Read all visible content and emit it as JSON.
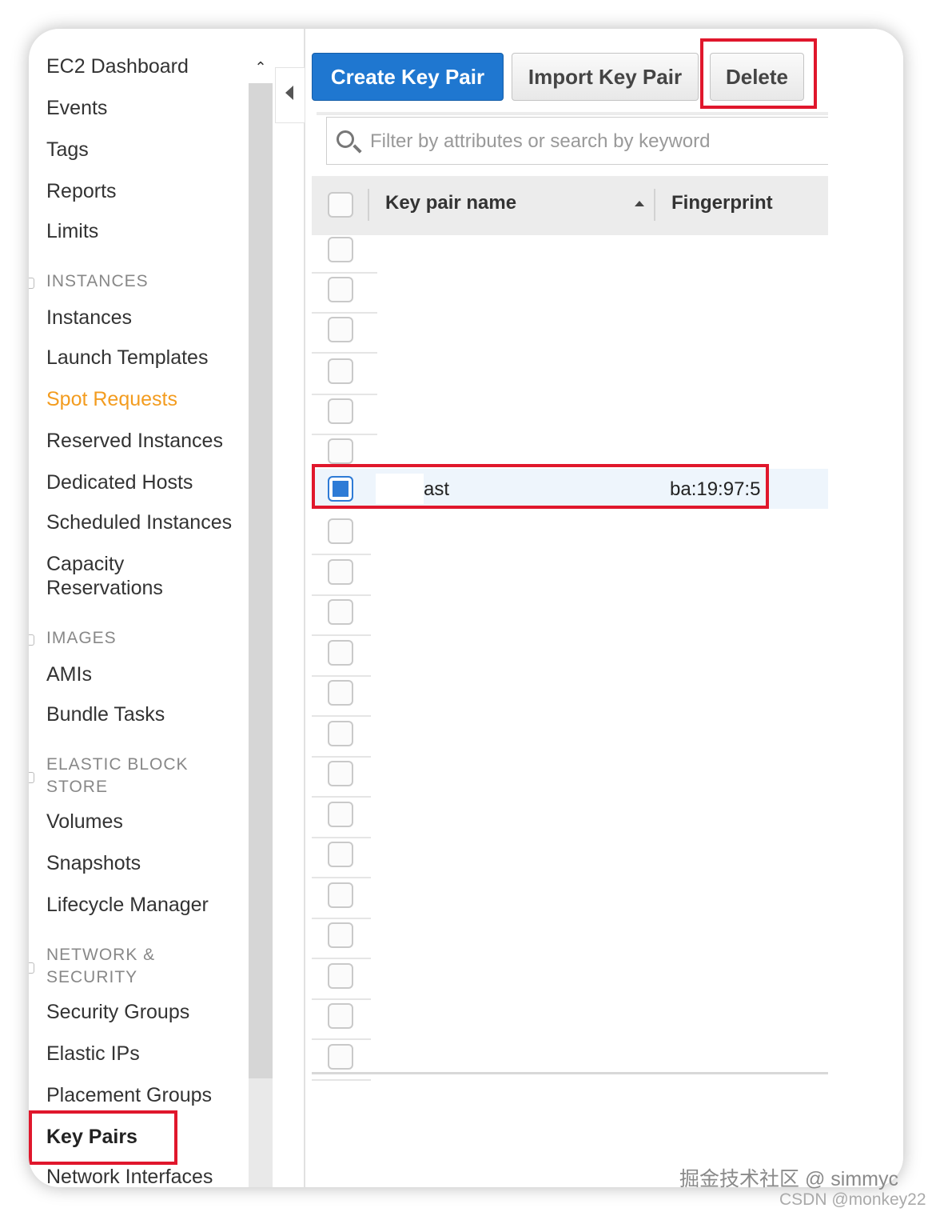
{
  "sidebar": {
    "items": [
      {
        "label": "EC2 Dashboard"
      },
      {
        "label": "Events"
      },
      {
        "label": "Tags"
      },
      {
        "label": "Reports"
      },
      {
        "label": "Limits"
      },
      {
        "label": "Instances"
      },
      {
        "label": "Launch Templates"
      },
      {
        "label": "Spot Requests"
      },
      {
        "label": "Reserved Instances"
      },
      {
        "label": "Dedicated Hosts"
      },
      {
        "label": "Scheduled Instances"
      },
      {
        "label": "Capacity Reservations"
      },
      {
        "label": "AMIs"
      },
      {
        "label": "Bundle Tasks"
      },
      {
        "label": "Volumes"
      },
      {
        "label": "Snapshots"
      },
      {
        "label": "Lifecycle Manager"
      },
      {
        "label": "Security Groups"
      },
      {
        "label": "Elastic IPs"
      },
      {
        "label": "Placement Groups"
      },
      {
        "label": "Key Pairs"
      },
      {
        "label": "Network Interfaces"
      }
    ],
    "sections": {
      "instances": "INSTANCES",
      "images": "IMAGES",
      "ebs": "ELASTIC BLOCK STORE",
      "network": "NETWORK & SECURITY"
    },
    "active_item": "Key Pairs"
  },
  "toolbar": {
    "create_label": "Create Key Pair",
    "import_label": "Import Key Pair",
    "delete_label": "Delete"
  },
  "search": {
    "placeholder": "Filter by attributes or search by keyword",
    "value": ""
  },
  "table": {
    "columns": [
      "Key pair name",
      "Fingerprint"
    ],
    "sort_column": "Key pair name",
    "sort_direction": "ascending",
    "selected_row": {
      "name": "ast",
      "fingerprint": "ba:19:97:5"
    }
  },
  "watermark": {
    "line1": "掘金技术社区 @ simmyc",
    "line2": "CSDN @monkey22"
  },
  "colors": {
    "primary_button": "#1f77d0",
    "highlight_box": "#e0172c",
    "active_nav": "#f39c1f"
  }
}
